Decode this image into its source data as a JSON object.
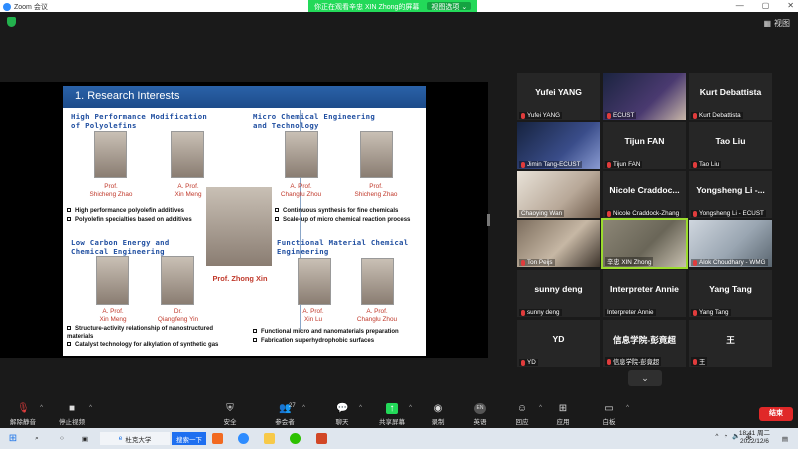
{
  "window": {
    "app_title": "Zoom 会议"
  },
  "banner": {
    "viewing_text": "你正在观看辛忠  XIN Zhong的屏幕",
    "view_options": "视图选项 ⌄"
  },
  "topbar": {
    "layout_label": "视图"
  },
  "slide": {
    "header": "1. Research Interests",
    "sections": {
      "s1": "High Performance Modification\nof Polyolefins",
      "s2": "Micro Chemical Engineering\nand Technology",
      "s3": "Low Carbon Energy and\nChemical Engineering",
      "s4": "Functional Material Chemical\nEngineering"
    },
    "people": {
      "p1": "Prof.\nShicheng Zhao",
      "p2": "A. Prof.\nXin Meng",
      "p3": "A. Prof.\nChanglu Zhou",
      "p4": "Prof.\nShicheng Zhao",
      "p5": "A. Prof.\nXin Meng",
      "p6": "Dr.\nQiangfeng Yin",
      "p7": "A. Prof.\nXin Lu",
      "p8": "A. Prof.\nChanglu Zhou",
      "center": "Prof. Zhong Xin"
    },
    "bullets": {
      "b1": "High performance polyolefin additives",
      "b2": "Polyolefin specialties based on additives",
      "b3": "Continuous synthesis for fine chemicals",
      "b4": "Scale-up of micro chemical reaction process",
      "b5": "Structure-activity relationship of nanostructured materials",
      "b6": "Catalyst technology for alkylation of synthetic gas",
      "b7": "Functional micro and nanomaterials preparation",
      "b8": "Fabrication superhydrophobic surfaces"
    }
  },
  "gallery": [
    {
      "big": "Yufei YANG",
      "label": "Yufei YANG"
    },
    {
      "big": "",
      "label": "ECUST"
    },
    {
      "big": "Kurt Debattista",
      "label": "Kurt Debattista"
    },
    {
      "big": "",
      "label": "Jimin Tang-ECUST"
    },
    {
      "big": "Tijun FAN",
      "label": "Tijun FAN"
    },
    {
      "big": "Tao Liu",
      "label": "Tao Liu"
    },
    {
      "big": "",
      "label": "Chaoying Wan"
    },
    {
      "big": "Nicole Craddoc...",
      "label": "Nicole Craddock-Zhang"
    },
    {
      "big": "Yongsheng Li -...",
      "label": "Yongsheng Li - ECUST"
    },
    {
      "big": "",
      "label": "Ton Peijs"
    },
    {
      "big": "",
      "label": "辛忠  XIN Zhong"
    },
    {
      "big": "",
      "label": "Alok Choudhary - WMG"
    },
    {
      "big": "sunny deng",
      "label": "sunny deng"
    },
    {
      "big": "Interpreter Annie",
      "label": "Interpreter Annie"
    },
    {
      "big": "Yang Tang",
      "label": "Yang Tang"
    },
    {
      "big": "YD",
      "label": "YD"
    },
    {
      "big": "信息学院-彭竟超",
      "label": "信息学院-彭竟超"
    },
    {
      "big": "王",
      "label": "王"
    }
  ],
  "toolbar": {
    "mute": "解除静音",
    "video": "停止视频",
    "security": "安全",
    "participants": "参会者",
    "participants_count": "27",
    "chat": "聊天",
    "share": "共享屏幕",
    "record": "录制",
    "english": "英语",
    "reactions": "回应",
    "apps": "应用",
    "whiteboard": "白板",
    "end": "结束"
  },
  "taskbar": {
    "chrome_tab": "杜克大学",
    "search_tab": "搜索一下",
    "lang": "英",
    "time": "18:41 周二",
    "date": "2022/12/6"
  },
  "colors": {
    "zoom_green": "#23d959",
    "slide_header": "#1d4c8a",
    "name_red": "#c0392b",
    "section_blue": "#1f4ea0",
    "end_red": "#e02828",
    "active_speaker": "#9bdc2e"
  }
}
